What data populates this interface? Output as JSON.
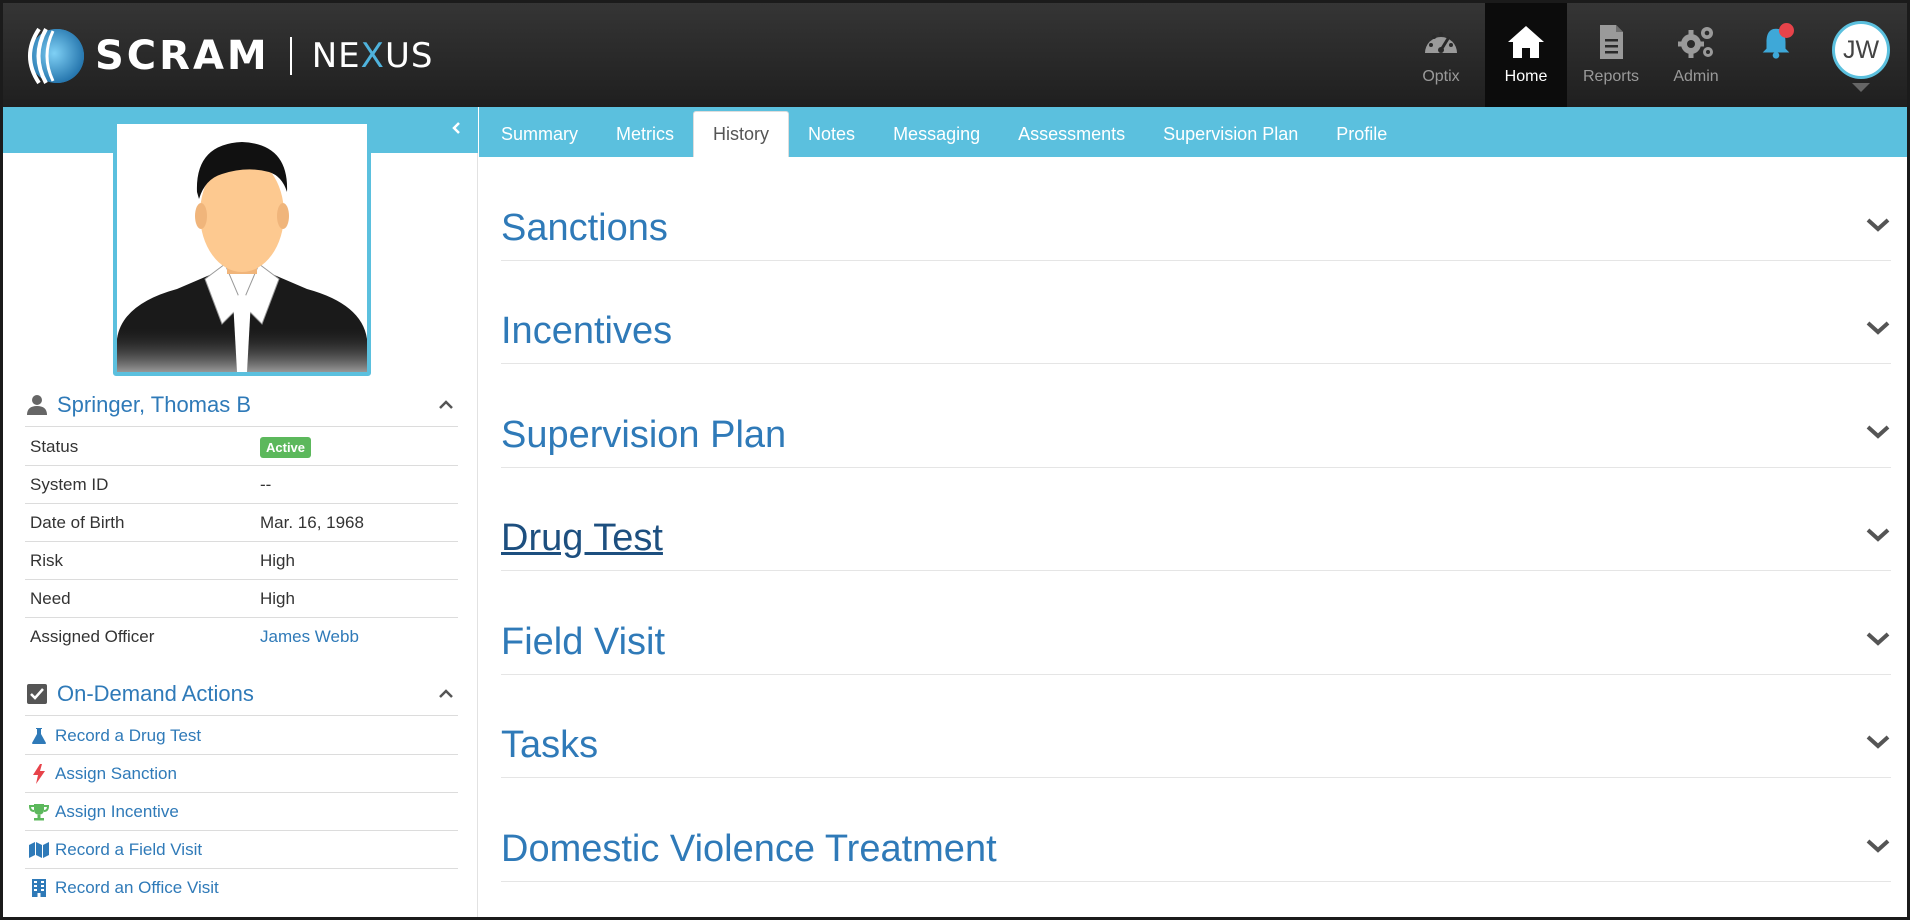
{
  "brand": {
    "name": "SCRAM",
    "product_pre": "NE",
    "product_x": "X",
    "product_post": "US"
  },
  "nav": {
    "optix": "Optix",
    "home": "Home",
    "reports": "Reports",
    "admin": "Admin",
    "user_initials": "JW"
  },
  "tabs": [
    {
      "label": "Summary"
    },
    {
      "label": "Metrics"
    },
    {
      "label": "History"
    },
    {
      "label": "Notes"
    },
    {
      "label": "Messaging"
    },
    {
      "label": "Assessments"
    },
    {
      "label": "Supervision Plan"
    },
    {
      "label": "Profile"
    }
  ],
  "active_tab": "History",
  "client": {
    "name": "Springer, Thomas B",
    "fields": [
      {
        "label": "Status",
        "value": "Active"
      },
      {
        "label": "System ID",
        "value": "--"
      },
      {
        "label": "Date of Birth",
        "value": "Mar. 16, 1968"
      },
      {
        "label": "Risk",
        "value": "High"
      },
      {
        "label": "Need",
        "value": "High"
      },
      {
        "label": "Assigned Officer",
        "value": "James Webb"
      }
    ]
  },
  "actions": {
    "title": "On-Demand Actions",
    "items": [
      {
        "label": "Record a Drug Test",
        "icon": "flask-icon"
      },
      {
        "label": "Assign Sanction",
        "icon": "bolt-icon"
      },
      {
        "label": "Assign Incentive",
        "icon": "trophy-icon"
      },
      {
        "label": "Record a Field Visit",
        "icon": "map-icon"
      },
      {
        "label": "Record an Office Visit",
        "icon": "building-icon"
      }
    ]
  },
  "history_sections": [
    {
      "title": "Sanctions"
    },
    {
      "title": "Incentives"
    },
    {
      "title": "Supervision Plan"
    },
    {
      "title": "Drug Test"
    },
    {
      "title": "Field Visit"
    },
    {
      "title": "Tasks"
    },
    {
      "title": "Domestic Violence Treatment"
    }
  ],
  "colors": {
    "accent": "#5bc0de",
    "link": "#2f7ab8",
    "active_badge": "#5cb85c",
    "notification": "#e7434a",
    "topbar": "#2a2a2a"
  }
}
